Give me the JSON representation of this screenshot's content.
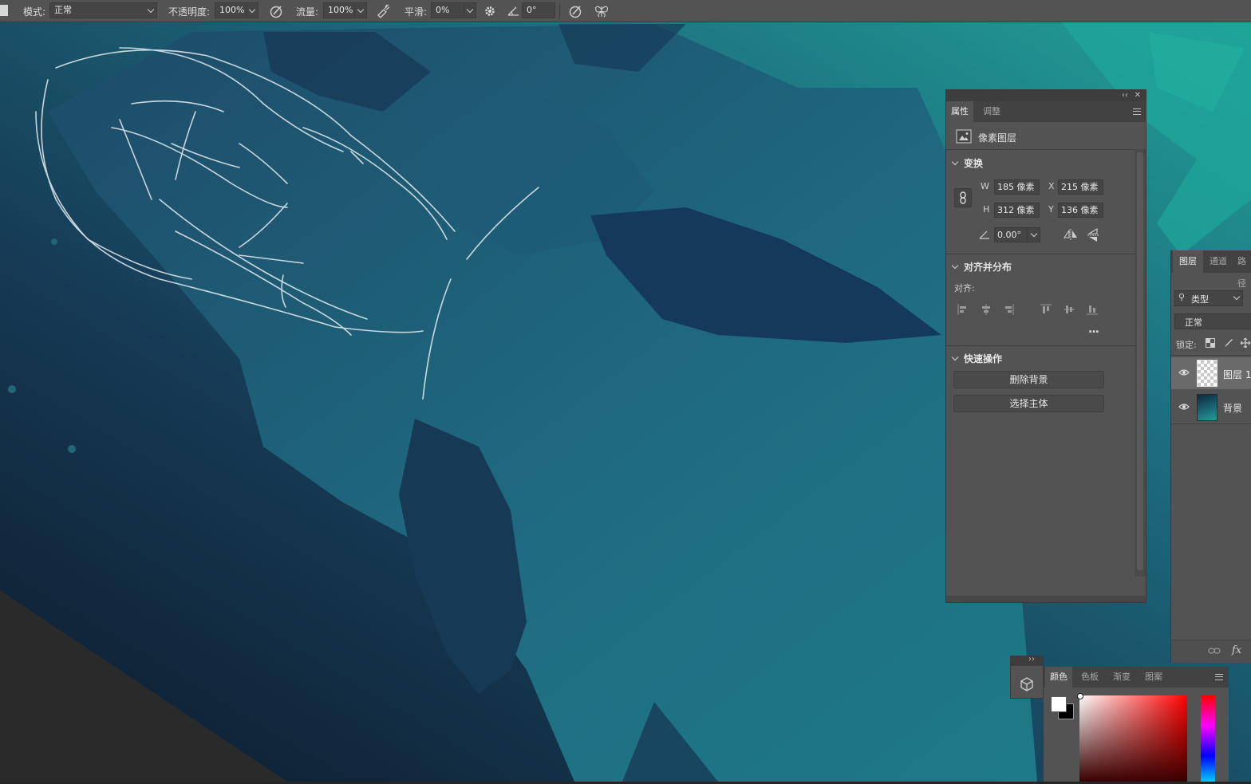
{
  "options_bar": {
    "mode_label": "模式:",
    "mode_value": "正常",
    "opacity_label": "不透明度:",
    "opacity_value": "100%",
    "flow_label": "流量:",
    "flow_value": "100%",
    "smoothing_label": "平滑:",
    "smoothing_value": "0%",
    "angle_value": "0°"
  },
  "properties_panel": {
    "tabs": [
      "属性",
      "调整"
    ],
    "layer_kind": "像素图层",
    "transform": {
      "title": "变换",
      "w_label": "W",
      "w_value": "185 像素",
      "h_label": "H",
      "h_value": "312 像素",
      "x_label": "X",
      "x_value": "215 像素",
      "y_label": "Y",
      "y_value": "136 像素",
      "angle_value": "0.00°"
    },
    "align": {
      "title": "对齐并分布",
      "align_label": "对齐:",
      "more": "..."
    },
    "quick_actions": {
      "title": "快速操作",
      "remove_bg": "删除背景",
      "select_subject": "选择主体"
    }
  },
  "layers_panel": {
    "tabs": [
      "图层",
      "通道",
      "路径"
    ],
    "filter_label": "类型",
    "blend_mode": "正常",
    "lock_label": "锁定:",
    "layers": [
      {
        "name": "图层 1",
        "visible": true,
        "selected": true
      },
      {
        "name": "背景",
        "visible": true,
        "selected": false
      }
    ]
  },
  "color_panel": {
    "tabs": [
      "颜色",
      "色板",
      "渐变",
      "图案"
    ],
    "foreground": "#ffffff",
    "background": "#000000"
  },
  "colors": {
    "ui_panel": "#535353",
    "ui_dark": "#424242",
    "canvas_teal": "#1f9a98",
    "canvas_navy": "#0e2638"
  }
}
